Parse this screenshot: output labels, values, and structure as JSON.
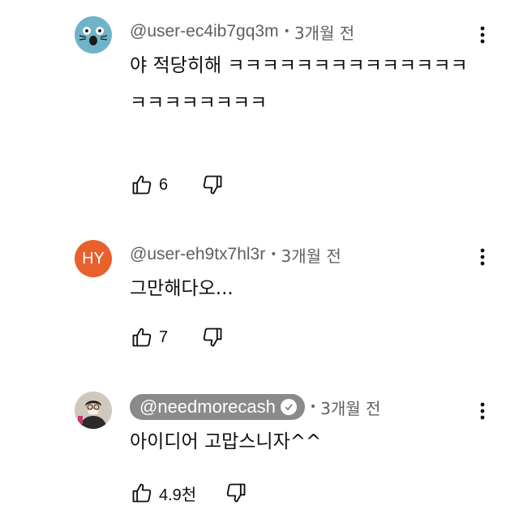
{
  "comments": [
    {
      "handle": "@user-ec4ib7gq3m",
      "separator": "•",
      "age": "3개월 전",
      "text": "야 적당히해 ㅋㅋㅋㅋㅋㅋㅋㅋㅋㅋㅋㅋㅋㅋㅋㅋㅋㅋㅋㅋㅋㅋ",
      "likes": "6",
      "avatar": "cat-icon"
    },
    {
      "handle": "@user-eh9tx7hl3r",
      "separator": "•",
      "age": "3개월 전",
      "text": "그만해다오...",
      "likes": "7",
      "avatar_initials": "HY"
    },
    {
      "handle": "@needmorecash",
      "separator": "•",
      "age": "3개월 전",
      "text": "아이디어 고맙스니자^^",
      "likes": "4.9천",
      "verified": true,
      "avatar": "user-photo"
    }
  ],
  "colors": {
    "text": "#0f0f0f",
    "secondary": "#606060",
    "hy_avatar": "#e8602c",
    "cat_avatar": "#6fb3c8",
    "creator_pill": "#8a8a8a"
  }
}
